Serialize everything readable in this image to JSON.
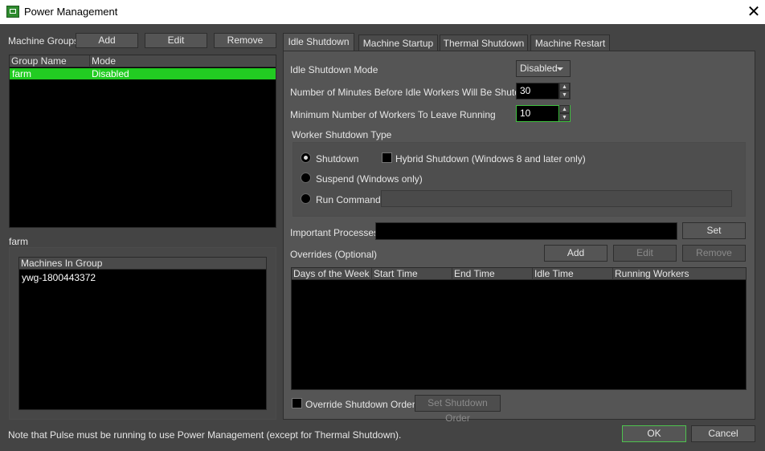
{
  "window": {
    "title": "Power Management",
    "app_icon": "thinkbox-monitor-icon",
    "close_icon": "close-icon"
  },
  "left": {
    "machine_groups_label": "Machine Groups",
    "add_label": "Add",
    "edit_label": "Edit",
    "remove_label": "Remove",
    "groups_columns": [
      "Group Name",
      "Mode"
    ],
    "groups_rows": [
      {
        "name": "farm",
        "mode": "Disabled"
      }
    ],
    "selected_group_label": "farm",
    "machines_header": "Machines In Group",
    "machines": [
      "ywg-1800443372"
    ]
  },
  "tabs": [
    {
      "label": "Idle Shutdown",
      "active": true
    },
    {
      "label": "Machine Startup",
      "active": false
    },
    {
      "label": "Thermal Shutdown",
      "active": false
    },
    {
      "label": "Machine Restart",
      "active": false
    }
  ],
  "idle": {
    "mode_label": "Idle Shutdown Mode",
    "mode_value": "Disabled",
    "minutes_label": "Number of Minutes Before Idle Workers Will Be Shutdown",
    "minutes_value": "30",
    "min_workers_label": "Minimum Number of Workers To Leave Running",
    "min_workers_value": "10",
    "shutdown_type_label": "Worker Shutdown Type",
    "shutdown_option": "Shutdown",
    "hybrid_option": "Hybrid Shutdown (Windows 8 and later only)",
    "suspend_option": "Suspend (Windows only)",
    "run_command_option": "Run Command",
    "run_command_value": "",
    "important_processes_label": "Important Processes",
    "important_processes_value": "",
    "set_label": "Set",
    "overrides_label": "Overrides (Optional)",
    "add_label": "Add",
    "edit_label": "Edit",
    "remove_label": "Remove",
    "overrides_columns": [
      "Days of the Week",
      "Start Time",
      "End Time",
      "Idle Time",
      "Running Workers"
    ],
    "override_order_label": "Override Shutdown Order",
    "set_order_label": "Set Shutdown Order"
  },
  "footer": {
    "note": "Note that Pulse must be running to use Power Management (except for Thermal Shutdown).",
    "ok_label": "OK",
    "cancel_label": "Cancel"
  },
  "colors": {
    "background": "#444444",
    "selection": "#22cc22",
    "focus": "#3ec03e"
  }
}
